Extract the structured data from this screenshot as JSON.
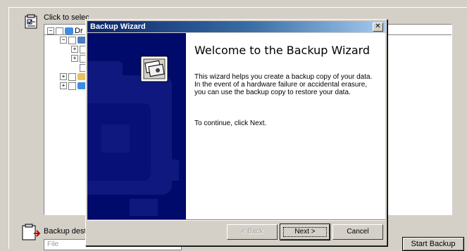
{
  "background_window": {
    "instruction_text": "Click to select the check box for any drive, folder or file that you want to back up.",
    "tree_root_label": "Dr",
    "backup_destination_label": "Backup destina",
    "destination_value": "File",
    "start_backup_label": "Start Backup"
  },
  "wizard": {
    "title": "Backup Wizard",
    "close_glyph": "✕",
    "heading": "Welcome to the Backup Wizard",
    "description": "This wizard helps you create a backup copy of your data. In the event of a hardware failure or accidental erasure, you can use the backup copy to restore your data.",
    "continue_text": "To continue, click Next.",
    "buttons": {
      "back": "< Back",
      "next": "Next >",
      "cancel": "Cancel"
    },
    "back_enabled": false
  },
  "colors": {
    "side_panel": "#000a6b",
    "titlebar_start": "#0a246a",
    "titlebar_end": "#a6caf0"
  }
}
